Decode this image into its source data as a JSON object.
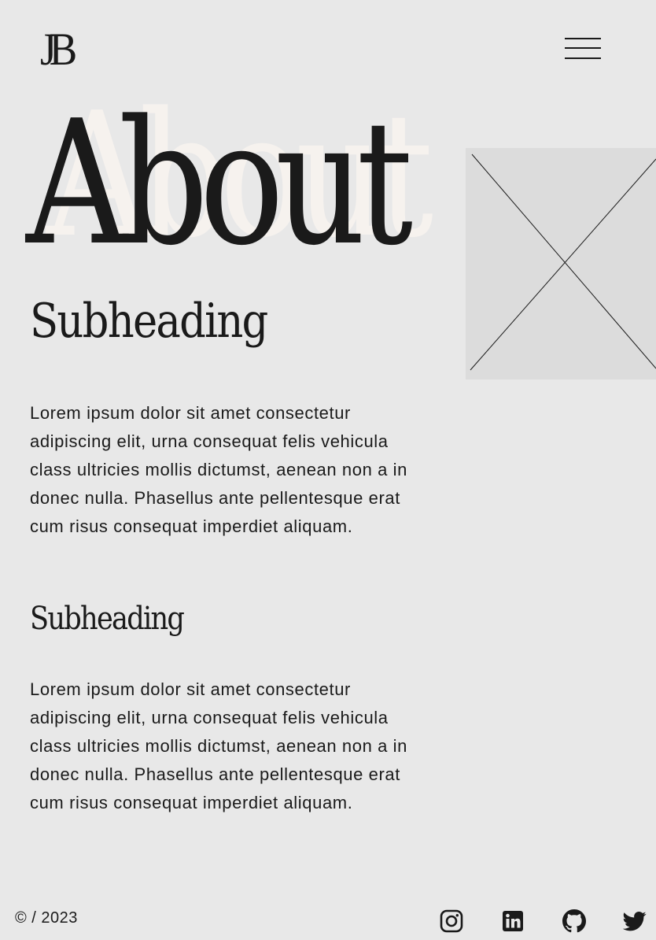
{
  "header": {
    "logo_text": "JB",
    "menu_icon": "hamburger-menu-icon"
  },
  "hero": {
    "title": "About",
    "title_ghost": "About"
  },
  "sections": [
    {
      "subheading": "Subheading",
      "body": "Lorem ipsum dolor sit amet consectetur adipiscing elit, urna consequat felis vehicula class ultricies mollis dictumst, aenean non a in donec nulla. Phasellus ante pellentesque erat cum risus consequat imperdiet aliquam."
    },
    {
      "subheading": "Subheading",
      "body": "Lorem ipsum dolor sit amet consectetur adipiscing elit, urna consequat felis vehicula class ultricies mollis dictumst, aenean non a in donec nulla. Phasellus ante pellentesque erat cum risus consequat imperdiet aliquam."
    }
  ],
  "image": {
    "type": "image-placeholder"
  },
  "footer": {
    "copyright": "© / 2023",
    "social_icons": [
      "instagram-icon",
      "linkedin-icon",
      "github-icon",
      "twitter-icon"
    ]
  },
  "colors": {
    "background": "#e8e8e8",
    "text": "#1a1a1a",
    "title_ghost": "#f6f2ee",
    "placeholder": "#dcdcdc"
  }
}
